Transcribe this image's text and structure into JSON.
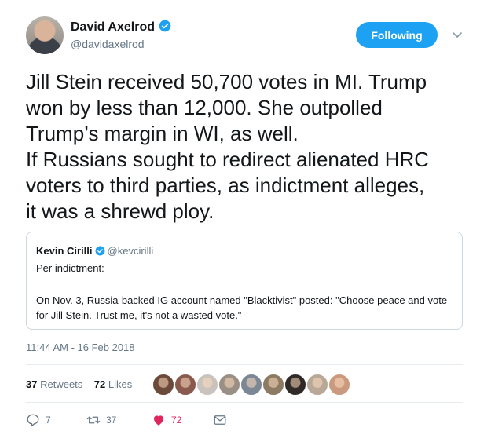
{
  "author": {
    "name": "David Axelrod",
    "handle": "@davidaxelrod"
  },
  "follow_button": {
    "label": "Following"
  },
  "tweet": {
    "text": "Jill Stein received 50,700 votes in MI.  Trump\nwon by less than 12,000.  She outpolled\nTrump’s margin in WI, as well.\nIf Russians sought to redirect alienated HRC\nvoters to third parties, as indictment alleges,\nit was a shrewd ploy."
  },
  "quoted": {
    "name": "Kevin Cirilli",
    "handle": "@kevcirilli",
    "line1": "Per indictment:",
    "body": "On Nov. 3, Russia-backed IG account named \"Blacktivist\" posted: \"Choose peace and vote for Jill Stein. Trust me, it's not a wasted vote.\""
  },
  "timestamp": "11:44 AM - 16 Feb 2018",
  "stats": {
    "retweets_count": "37",
    "retweets_label": "Retweets",
    "likes_count": "72",
    "likes_label": "Likes"
  },
  "liker_colors": [
    "#6b4a3a",
    "#8a5a4e",
    "#c9c2bd",
    "#9a8f84",
    "#7b8794",
    "#8c7a63",
    "#2f2a28",
    "#b8a898",
    "#c99a7e"
  ],
  "actions": {
    "replies": "7",
    "retweets": "37",
    "likes": "72"
  },
  "colors": {
    "accent": "#1da1f2",
    "like": "#e0245e",
    "muted": "#657786"
  }
}
